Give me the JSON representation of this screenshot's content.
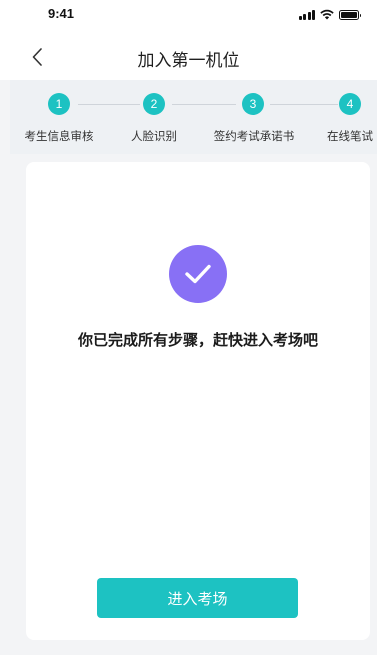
{
  "status_bar": {
    "time": "9:41"
  },
  "header": {
    "title": "加入第一机位"
  },
  "steps": [
    {
      "number": "1",
      "label": "考生信息审核"
    },
    {
      "number": "2",
      "label": "人脸识别"
    },
    {
      "number": "3",
      "label": "签约考试承诺书"
    },
    {
      "number": "4",
      "label": "在线笔试"
    }
  ],
  "main": {
    "message": "你已完成所有步骤，赶快进入考场吧",
    "enter_button": "进入考场"
  },
  "colors": {
    "accent": "#1dc2c2",
    "check_purple": "#8870f5"
  },
  "icons": {
    "back": "chevron-left-icon",
    "done": "check-icon",
    "signal": "cellular-signal-icon",
    "wifi": "wifi-icon",
    "battery": "battery-icon"
  }
}
